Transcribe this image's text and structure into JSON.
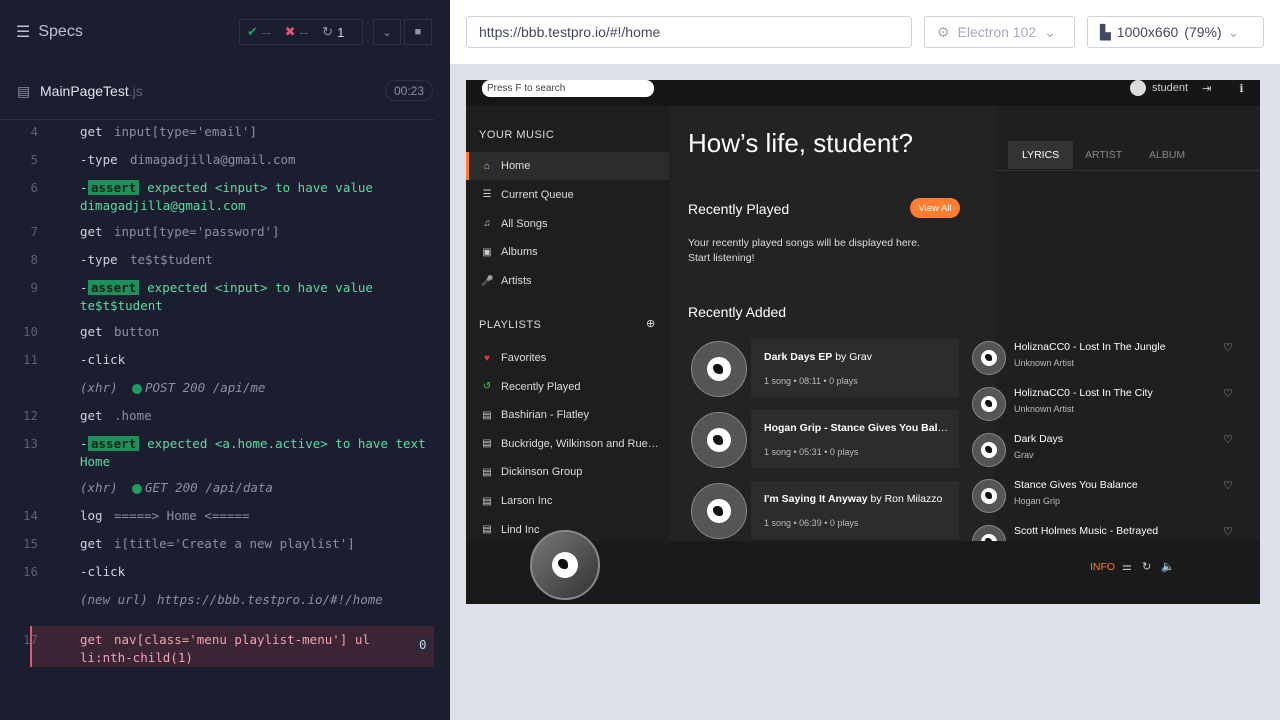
{
  "runner": {
    "specs_label": "Specs",
    "passed": "--",
    "failed": "--",
    "pending": "1",
    "file_name": "MainPageTest",
    "file_ext": ".js",
    "timer": "00:23",
    "commands": [
      {
        "n": "4",
        "name": "get",
        "msg": "input[type='email']"
      },
      {
        "n": "5",
        "name": "-type",
        "msg": "dimagadjilla@gmail.com"
      },
      {
        "n": "6",
        "name": "-",
        "badge": "assert",
        "msg": "expected <input> to have value",
        "msg2": "dimagadjilla@gmail.com"
      },
      {
        "n": "7",
        "name": "get",
        "msg": "input[type='password']"
      },
      {
        "n": "8",
        "name": "-type",
        "msg": "te$t$tudent"
      },
      {
        "n": "9",
        "name": "-",
        "badge": "assert",
        "msg": "expected <input> to have value",
        "msg2": "te$t$tudent"
      },
      {
        "n": "10",
        "name": "get",
        "msg": "button"
      },
      {
        "n": "11",
        "name": "-click",
        "msg": ""
      },
      {
        "n": "",
        "name": "(xhr)",
        "msg": "POST 200 /api/me"
      },
      {
        "n": "12",
        "name": "get",
        "msg": ".home"
      },
      {
        "n": "13",
        "name": "-",
        "badge": "assert",
        "msg": "expected <a.home.active> to have text",
        "msg2": "Home"
      },
      {
        "n": "",
        "name": "(xhr)",
        "msg": "GET 200 /api/data"
      },
      {
        "n": "14",
        "name": "log",
        "msg": "=====> Home <====="
      },
      {
        "n": "15",
        "name": "get",
        "msg": "i[title='Create a new playlist']"
      },
      {
        "n": "16",
        "name": "-click",
        "msg": ""
      },
      {
        "n": "",
        "name": "(new url)",
        "msg": "https://bbb.testpro.io/#!/home"
      },
      {
        "n": "17",
        "name": "get",
        "msg": "nav[class='menu playlist-menu'] ul",
        "msg2": "li:nth-child(1)",
        "count": "0"
      }
    ]
  },
  "browser": {
    "url": "https://bbb.testpro.io/#!/home",
    "engine": "Electron 102",
    "viewport": "1000x660",
    "zoom": "(79%)"
  },
  "app": {
    "search_placeholder": "Press F to search",
    "user": "student",
    "your_music": "YOUR MUSIC",
    "nav": [
      "Home",
      "Current Queue",
      "All Songs",
      "Albums",
      "Artists"
    ],
    "playlists_title": "PLAYLISTS",
    "playlists": [
      "Favorites",
      "Recently Played",
      "Bashirian - Flatley",
      "Buckridge, Wilkinson and Ruecker",
      "Dickinson Group",
      "Larson Inc",
      "Lind Inc"
    ],
    "greeting": "How’s life, student?",
    "recently_played": "Recently Played",
    "view_all": "View All",
    "rp_empty_1": "Your recently played songs will be displayed here.",
    "rp_empty_2": "Start listening!",
    "recently_added": "Recently Added",
    "albums": [
      {
        "title": "Dark Days EP",
        "by": "Grav",
        "meta": "1 song • 08:11 • 0 plays"
      },
      {
        "title": "Hogan Grip - Stance Gives You Balance",
        "by": "",
        "meta": "1 song • 05:31 • 0 plays"
      },
      {
        "title": "I'm Saying It Anyway",
        "by": "Ron Milazzo",
        "meta": "1 song • 06:39 • 0 plays"
      }
    ],
    "songs": [
      {
        "title": "HoliznaCC0 - Lost In The Jungle",
        "artist": "Unknown Artist"
      },
      {
        "title": "HoliznaCC0 - Lost In The City",
        "artist": "Unknown Artist"
      },
      {
        "title": "Dark Days",
        "artist": "Grav"
      },
      {
        "title": "Stance Gives You Balance",
        "artist": "Hogan Grip"
      },
      {
        "title": "Scott Holmes Music - Betrayed",
        "artist": ""
      }
    ],
    "tabs": [
      "LYRICS",
      "ARTIST",
      "ALBUM"
    ],
    "info": "INFO"
  }
}
